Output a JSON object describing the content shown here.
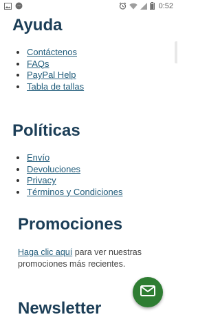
{
  "status_bar": {
    "time": "0:52",
    "left_icons": [
      "gallery-icon",
      "messenger-icon"
    ],
    "right_icons": [
      "alarm-icon",
      "wifi-icon",
      "signal-icon",
      "battery-icon"
    ]
  },
  "sections": {
    "ayuda": {
      "title": "Ayuda",
      "links": [
        "Contáctenos",
        "FAQs",
        "PayPal Help",
        "Tabla de tallas"
      ]
    },
    "politicas": {
      "title": "Políticas",
      "links": [
        "Envío",
        "Devoluciones",
        "Privacy",
        "Términos y Condiciones"
      ]
    },
    "promociones": {
      "title": "Promociones",
      "link_text": "Haga clic aquí",
      "text": " para ver nuestras promociones más recientes."
    },
    "newsletter": {
      "title": "Newsletter"
    }
  },
  "fab": {
    "icon": "mail-icon",
    "color": "#2e7d32"
  },
  "colors": {
    "heading": "#1c3e57",
    "link": "#1f5b7a"
  }
}
